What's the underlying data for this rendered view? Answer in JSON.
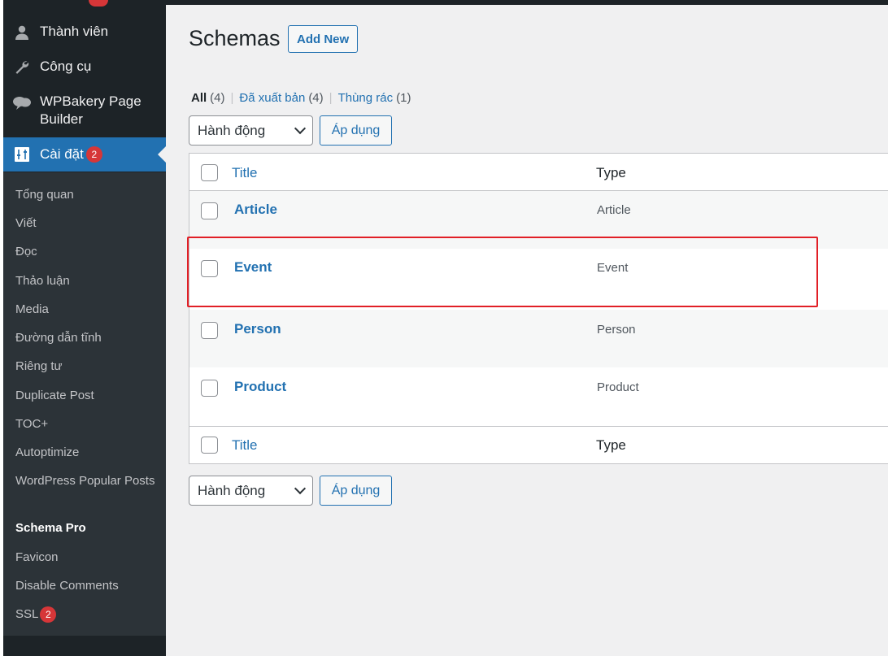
{
  "sidebar": {
    "menu": [
      {
        "label": "Thành viên",
        "icon": "user-icon"
      },
      {
        "label": "Công cụ",
        "icon": "wrench-icon"
      },
      {
        "label": "WPBakery Page Builder",
        "icon": "wpbakery-cloud-icon"
      },
      {
        "label": "Cài đặt",
        "icon": "settings-sliders-icon",
        "badge": "2"
      }
    ],
    "submenu": [
      {
        "label": "Tổng quan"
      },
      {
        "label": "Viết"
      },
      {
        "label": "Đọc"
      },
      {
        "label": "Thảo luận"
      },
      {
        "label": "Media"
      },
      {
        "label": "Đường dẫn tĩnh"
      },
      {
        "label": "Riêng tư"
      },
      {
        "label": "Duplicate Post"
      },
      {
        "label": "TOC+"
      },
      {
        "label": "Autoptimize"
      },
      {
        "label": "WordPress Popular Posts"
      },
      {
        "label": "Schema Pro"
      },
      {
        "label": "Favicon"
      },
      {
        "label": "Disable Comments"
      },
      {
        "label": "SSL",
        "badge": "2"
      }
    ]
  },
  "page": {
    "title": "Schemas",
    "add_new": "Add New"
  },
  "filters": {
    "all": {
      "label": "All",
      "count": "(4)"
    },
    "published": {
      "label": "Đã xuất bản",
      "count": "(4)"
    },
    "trash": {
      "label": "Thùng rác",
      "count": "(1)"
    },
    "separator": "|"
  },
  "bulk_actions": {
    "selected": "Hành động",
    "apply": "Áp dụng"
  },
  "table": {
    "columns": {
      "title": "Title",
      "type": "Type"
    },
    "rows": [
      {
        "title": "Article",
        "type": "Article"
      },
      {
        "title": "Event",
        "type": "Event"
      },
      {
        "title": "Person",
        "type": "Person"
      },
      {
        "title": "Product",
        "type": "Product"
      }
    ]
  },
  "colors": {
    "sidebar_bg": "#1d2327",
    "submenu_bg": "#2c3338",
    "accent": "#2271b1",
    "badge": "#d63638",
    "highlight_border": "#e11f26"
  }
}
